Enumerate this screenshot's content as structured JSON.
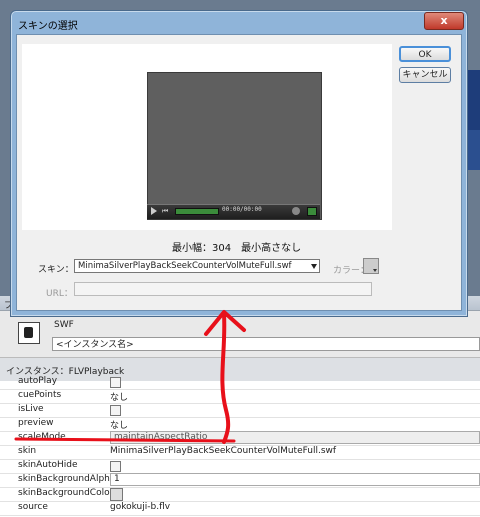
{
  "dialog": {
    "title": "スキンの選択",
    "close_label": "x",
    "ok_label": "OK",
    "cancel_label": "キャンセル",
    "min_size_text": "最小幅：304　最小高さなし",
    "skin_label": "スキン：",
    "skin_value": "MinimaSilverPlayBackSeekCounterVolMuteFull.swf",
    "color_label": "カラー：",
    "url_label": "URL：",
    "player_time": "00:00/00:00"
  },
  "panel": {
    "tab_label": "プロ",
    "swf_label": "SWF",
    "instance_name_placeholder": "<インスタンス名>",
    "instance_label": "インスタンス：FLVPlayback"
  },
  "properties": [
    {
      "name": "autoPlay",
      "type": "checkbox",
      "value": ""
    },
    {
      "name": "cuePoints",
      "type": "text",
      "value": "なし"
    },
    {
      "name": "isLive",
      "type": "checkbox",
      "value": ""
    },
    {
      "name": "preview",
      "type": "text",
      "value": "なし"
    },
    {
      "name": "scaleMode",
      "type": "input-gray",
      "value": "maintainAspectRatio"
    },
    {
      "name": "skin",
      "type": "text",
      "value": "MinimaSilverPlayBackSeekCounterVolMuteFull.swf"
    },
    {
      "name": "skinAutoHide",
      "type": "checkbox",
      "value": ""
    },
    {
      "name": "skinBackgroundAlpha",
      "type": "input",
      "value": "1"
    },
    {
      "name": "skinBackgroundColor",
      "type": "swatch",
      "value": ""
    },
    {
      "name": "source",
      "type": "text",
      "value": "gokokuji-b.flv"
    }
  ],
  "colors": {
    "annotation": "#e8101a",
    "dialog_frame": "#8fb4d9"
  }
}
